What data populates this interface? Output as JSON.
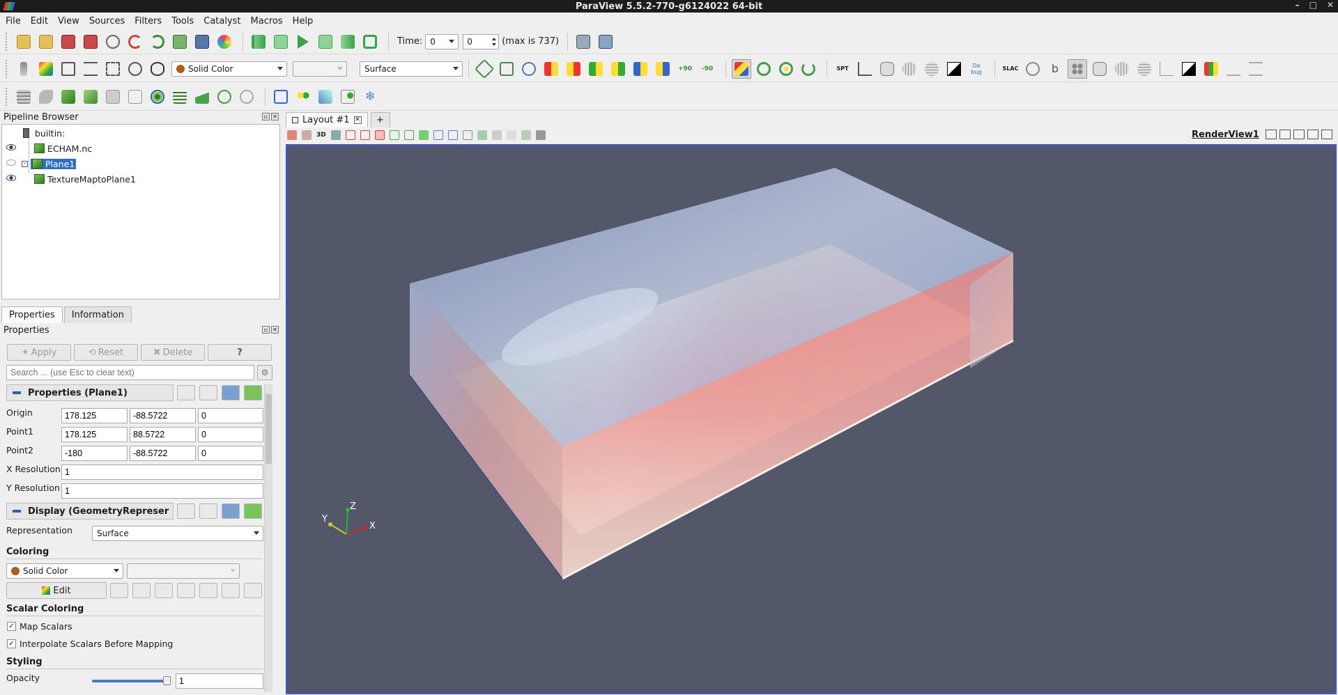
{
  "window": {
    "title": "ParaView 5.5.2-770-g6124022 64-bit",
    "controls": [
      "–",
      "□",
      "✕"
    ]
  },
  "menu": [
    "File",
    "Edit",
    "View",
    "Sources",
    "Filters",
    "Tools",
    "Catalyst",
    "Macros",
    "Help"
  ],
  "time": {
    "label": "Time:",
    "value": "0",
    "step": "0",
    "max_text": "(max is 737)"
  },
  "toolbar2": {
    "coloring": "Solid Color",
    "representation": "Surface",
    "rot_plus": "+90",
    "rot_minus": "-90",
    "debug": "De bug",
    "spt": "SPT",
    "slac": "SLAC"
  },
  "pipeline": {
    "title": "Pipeline Browser",
    "items": [
      {
        "label": "builtin:"
      },
      {
        "label": "ECHAM.nc"
      },
      {
        "label": "Plane1"
      },
      {
        "label": "TextureMaptoPlane1"
      }
    ]
  },
  "tabs": [
    "Properties",
    "Information"
  ],
  "properties": {
    "title": "Properties",
    "buttons": {
      "apply": "Apply",
      "reset": "Reset",
      "delete": "Delete",
      "help": "?"
    },
    "search_placeholder": "Search ... (use Esc to clear text)",
    "section_title": "Properties (Plane1)",
    "rows": [
      {
        "label": "Origin",
        "values": [
          "178.125",
          "-88.5722",
          "0"
        ]
      },
      {
        "label": "Point1",
        "values": [
          "178.125",
          "88.5722",
          "0"
        ]
      },
      {
        "label": "Point2",
        "values": [
          "-180",
          "-88.5722",
          "0"
        ]
      }
    ],
    "x_resolution": {
      "label": "X Resolution",
      "value": "1"
    },
    "y_resolution": {
      "label": "Y Resolution",
      "value": "1"
    },
    "display_title": "Display (GeometryRepreser",
    "representation": {
      "label": "Representation",
      "value": "Surface"
    },
    "coloring_hdr": "Coloring",
    "coloring_value": "Solid Color",
    "edit": "Edit",
    "scalar_hdr": "Scalar Coloring",
    "map_scalars": "Map Scalars",
    "interpolate": "Interpolate Scalars Before Mapping",
    "styling_hdr": "Styling",
    "opacity": {
      "label": "Opacity",
      "value": "1",
      "level": 1.0
    }
  },
  "layout": {
    "tab": "Layout #1",
    "plus": "+",
    "view_name": "RenderView1",
    "view_3d": "3D"
  },
  "axes": {
    "x": "X",
    "y": "Y",
    "z": "Z"
  },
  "colors": {
    "accent": "#2f6fbf",
    "render_bg": "#525769",
    "view_border": "#4455cc"
  }
}
